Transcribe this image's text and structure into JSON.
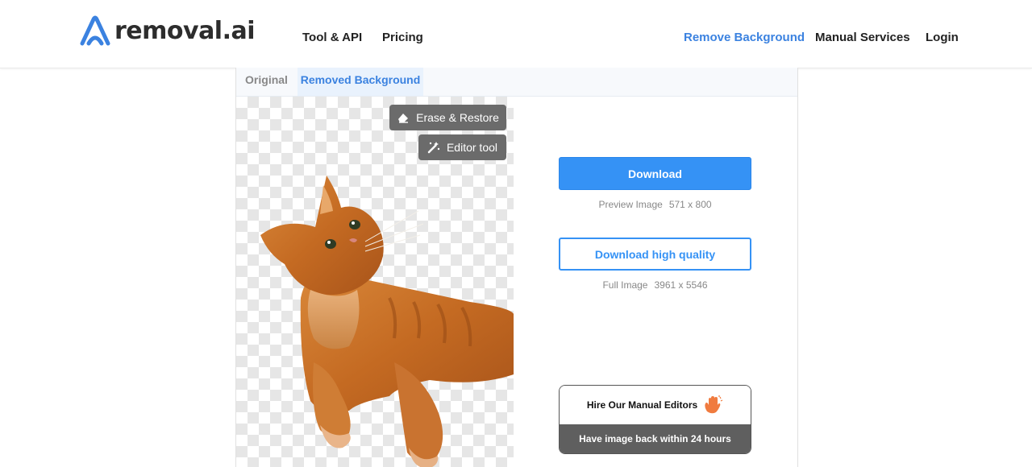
{
  "brand": {
    "name": "removal.ai",
    "accent": "#3b82e0"
  },
  "nav": {
    "left": [
      {
        "label": "Tool & API"
      },
      {
        "label": "Pricing"
      }
    ],
    "right": [
      {
        "label": "Remove Background"
      },
      {
        "label": "Manual Services"
      },
      {
        "label": "Login"
      }
    ]
  },
  "tabs": [
    {
      "label": "Original"
    },
    {
      "label": "Removed Background"
    }
  ],
  "preview": {
    "erase_label": "Erase & Restore",
    "editor_label": "Editor tool"
  },
  "download": {
    "label": "Download",
    "meta_label": "Preview Image",
    "meta_size": "571 x 800"
  },
  "download_hq": {
    "label": "Download high quality",
    "meta_label": "Full Image",
    "meta_size": "3961 x 5546"
  },
  "hire": {
    "title": "Hire Our Manual Editors",
    "subtitle": "Have image back within 24 hours"
  }
}
